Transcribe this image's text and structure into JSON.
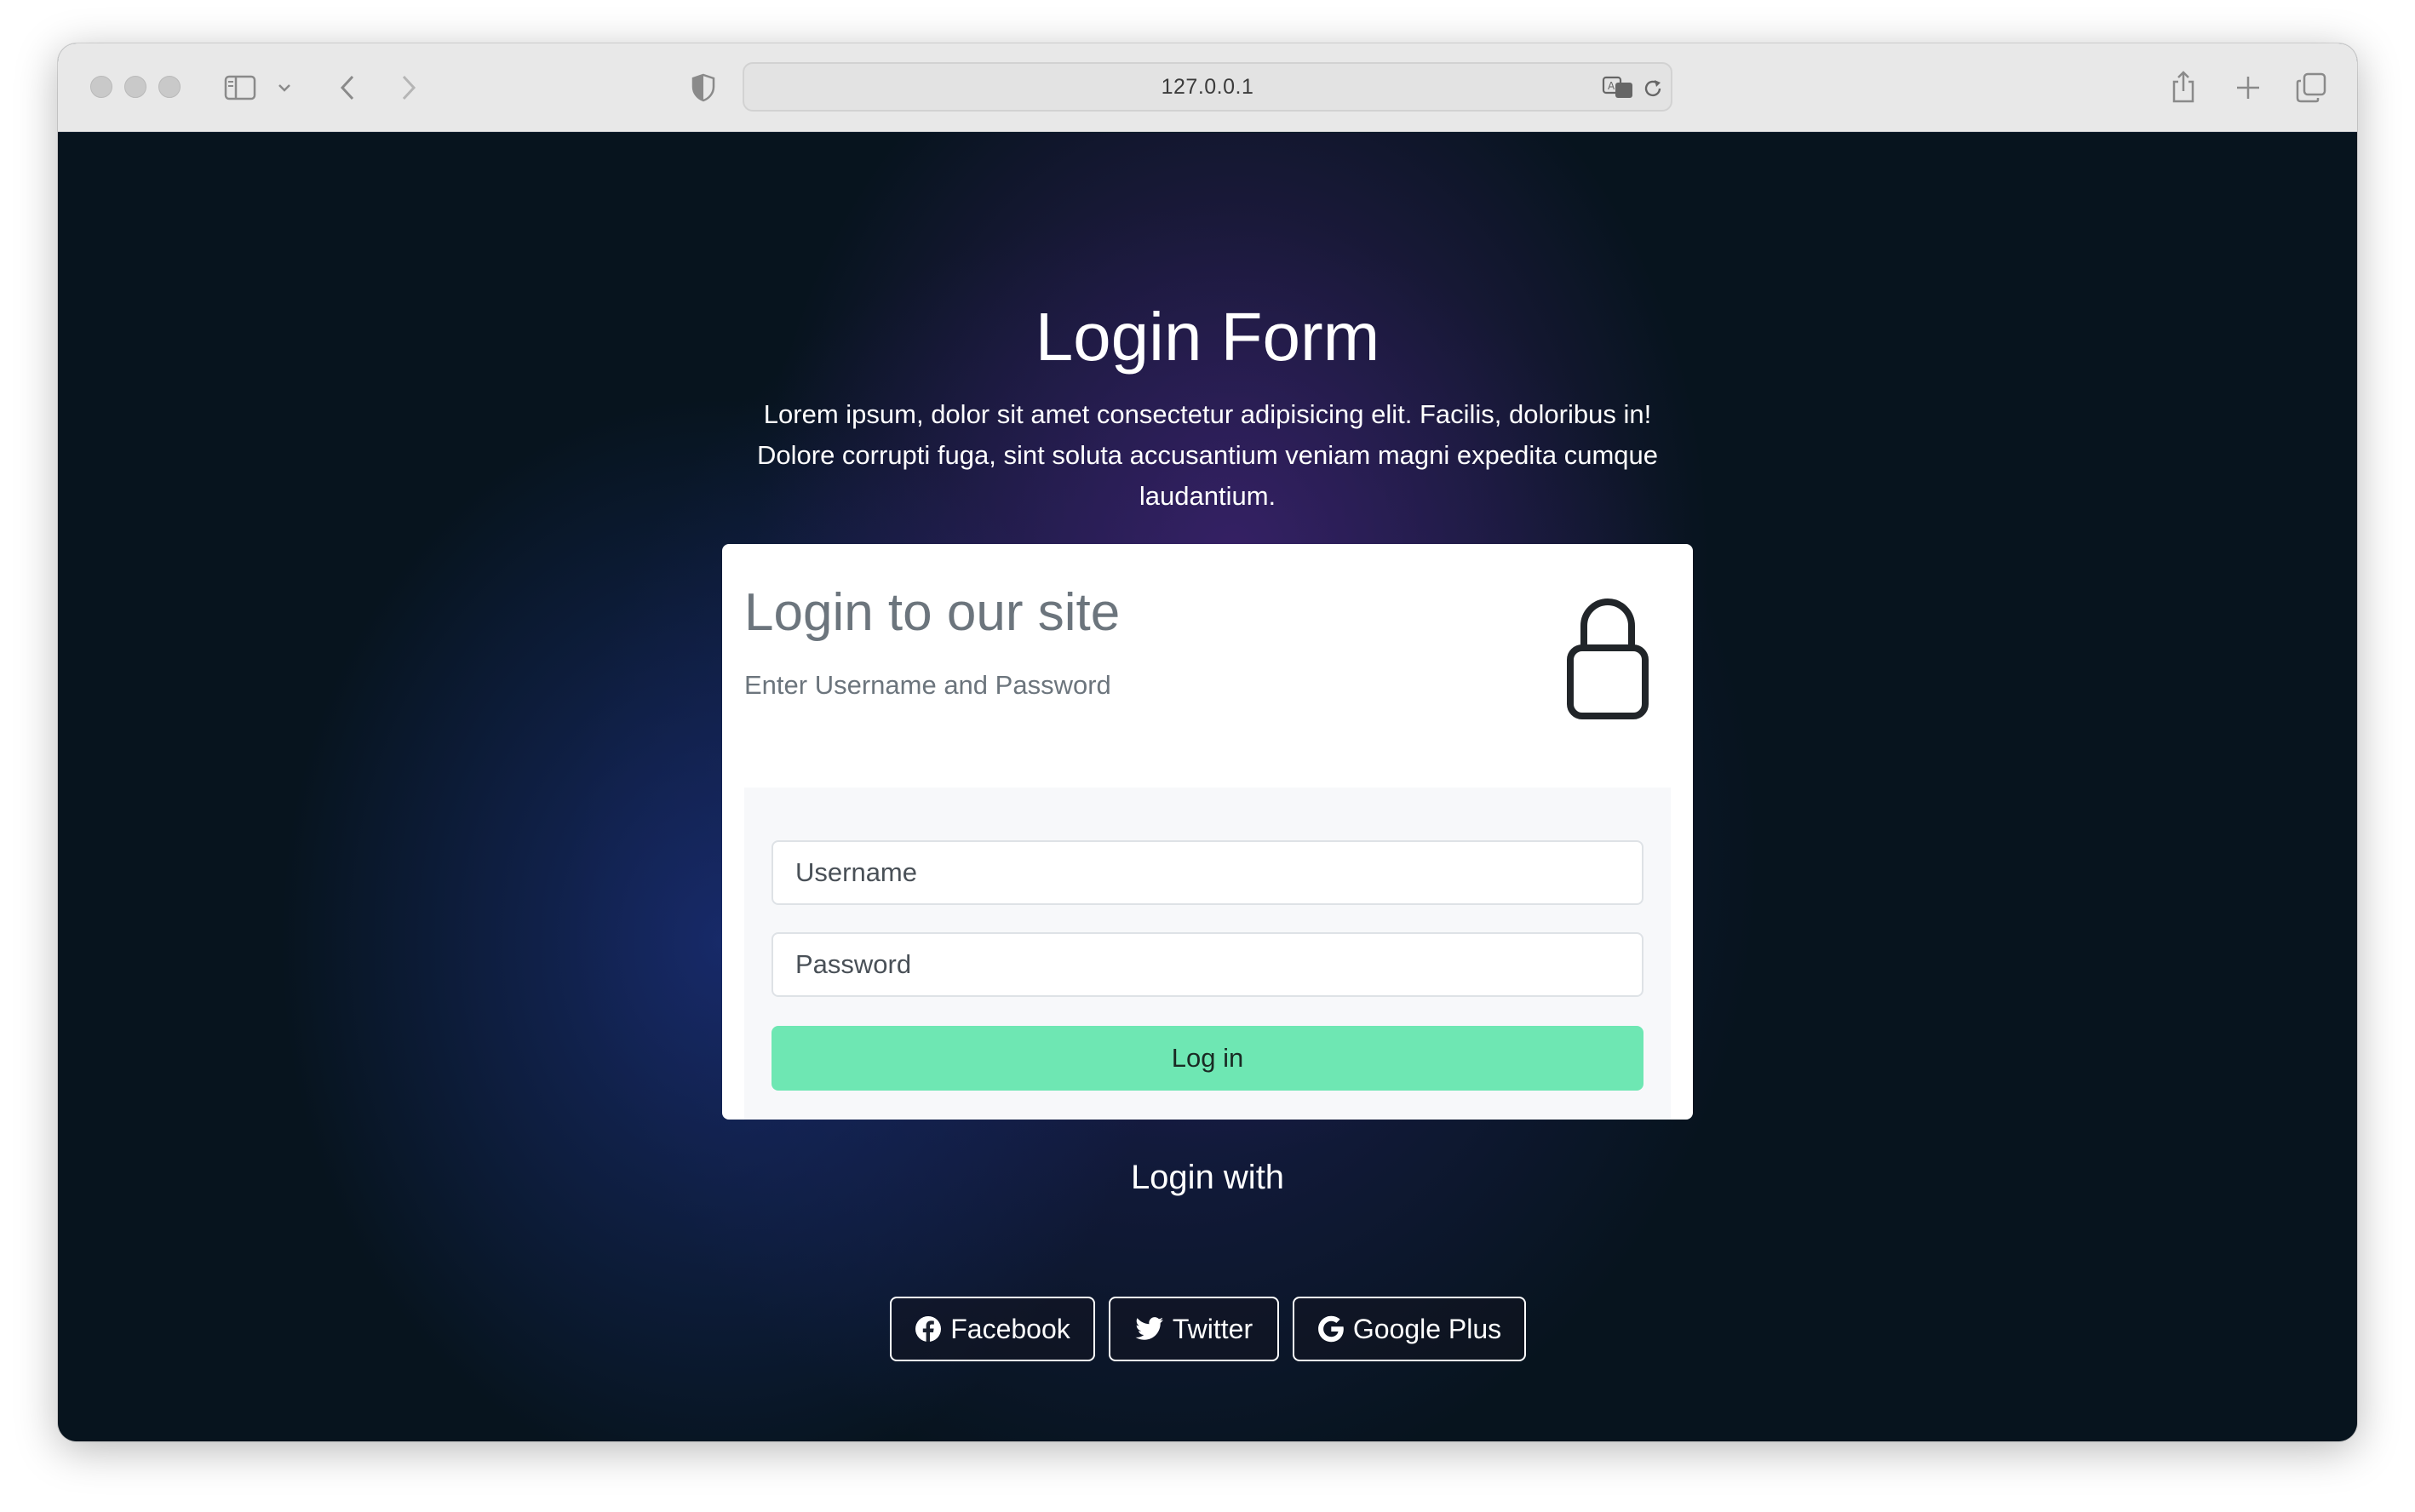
{
  "browser": {
    "url": "127.0.0.1",
    "icons": [
      "sidebar-icon",
      "chevron-down-icon",
      "back-icon",
      "forward-icon",
      "shield-icon",
      "translate-icon",
      "reload-icon",
      "share-icon",
      "new-tab-icon",
      "tabs-overview-icon"
    ]
  },
  "page": {
    "title": "Login Form",
    "description": "Lorem ipsum, dolor sit amet consectetur adipisicing elit. Facilis, doloribus in! Dolore corrupti fuga, sint soluta accusantium veniam magni expedita cumque laudantium."
  },
  "card": {
    "title": "Login to our site",
    "subtitle": "Enter Username and Password",
    "icon": "lock-icon",
    "username_placeholder": "Username",
    "password_placeholder": "Password",
    "login_label": "Log in"
  },
  "social": {
    "heading": "Login with",
    "buttons": [
      {
        "label": "Facebook",
        "icon": "facebook-icon"
      },
      {
        "label": "Twitter",
        "icon": "twitter-icon"
      },
      {
        "label": "Google Plus",
        "icon": "google-icon"
      }
    ]
  },
  "colors": {
    "accent_button": "#6ee7b3",
    "background_dark": "#07141e",
    "card_text": "#6c757d"
  }
}
